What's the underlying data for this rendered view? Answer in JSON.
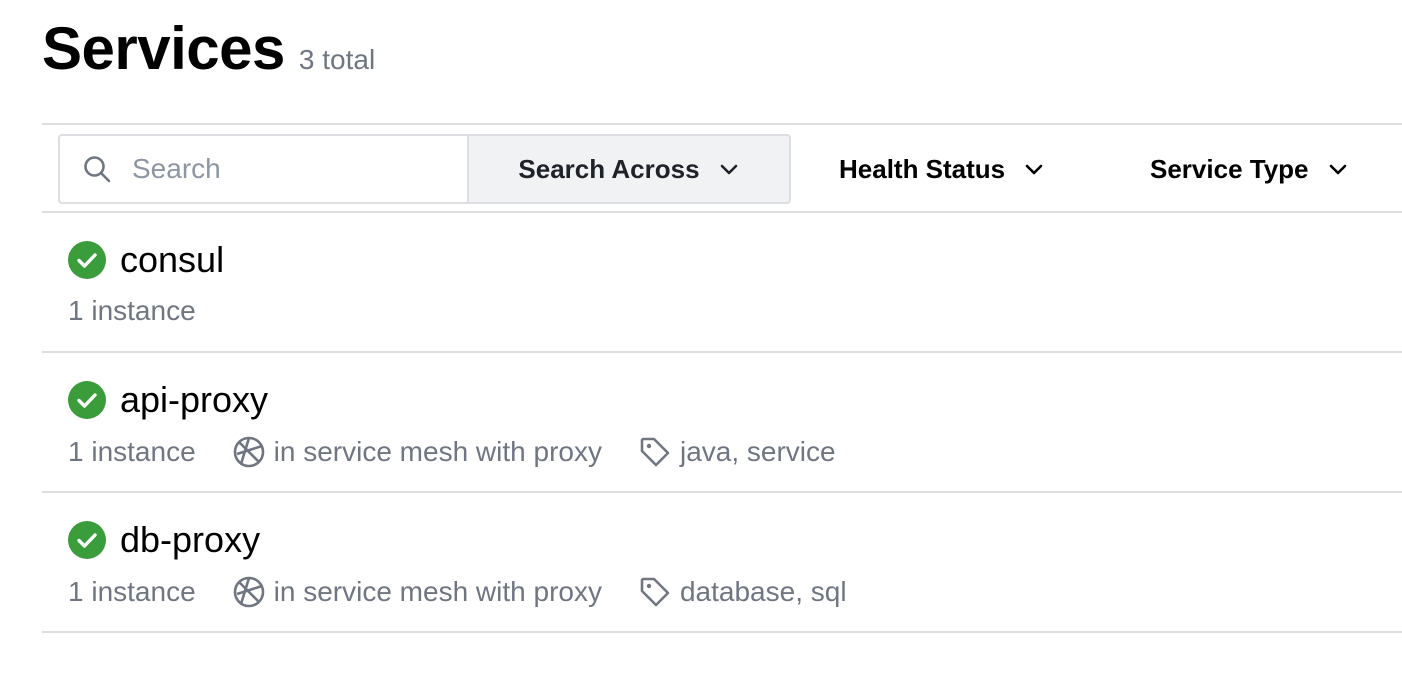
{
  "header": {
    "title": "Services",
    "count": "3 total"
  },
  "toolbar": {
    "search_placeholder": "Search",
    "search_across_label": "Search Across",
    "health_status_label": "Health Status",
    "service_type_label": "Service Type"
  },
  "services": [
    {
      "name": "consul",
      "status": "passing",
      "instances": "1 instance",
      "mesh": "",
      "tags": ""
    },
    {
      "name": "api-proxy",
      "status": "passing",
      "instances": "1 instance",
      "mesh": "in service mesh with proxy",
      "tags": "java, service"
    },
    {
      "name": "db-proxy",
      "status": "passing",
      "instances": "1 instance",
      "mesh": "in service mesh with proxy",
      "tags": "database, sql"
    }
  ],
  "colors": {
    "passing": "#3a9c3a",
    "muted_text": "#6f7682",
    "border": "#dcdee2"
  },
  "icons": {
    "health": "check-circle-icon",
    "mesh": "mesh-icon",
    "tag": "tag-icon",
    "search": "search-icon",
    "dropdown": "chevron-down-icon"
  }
}
